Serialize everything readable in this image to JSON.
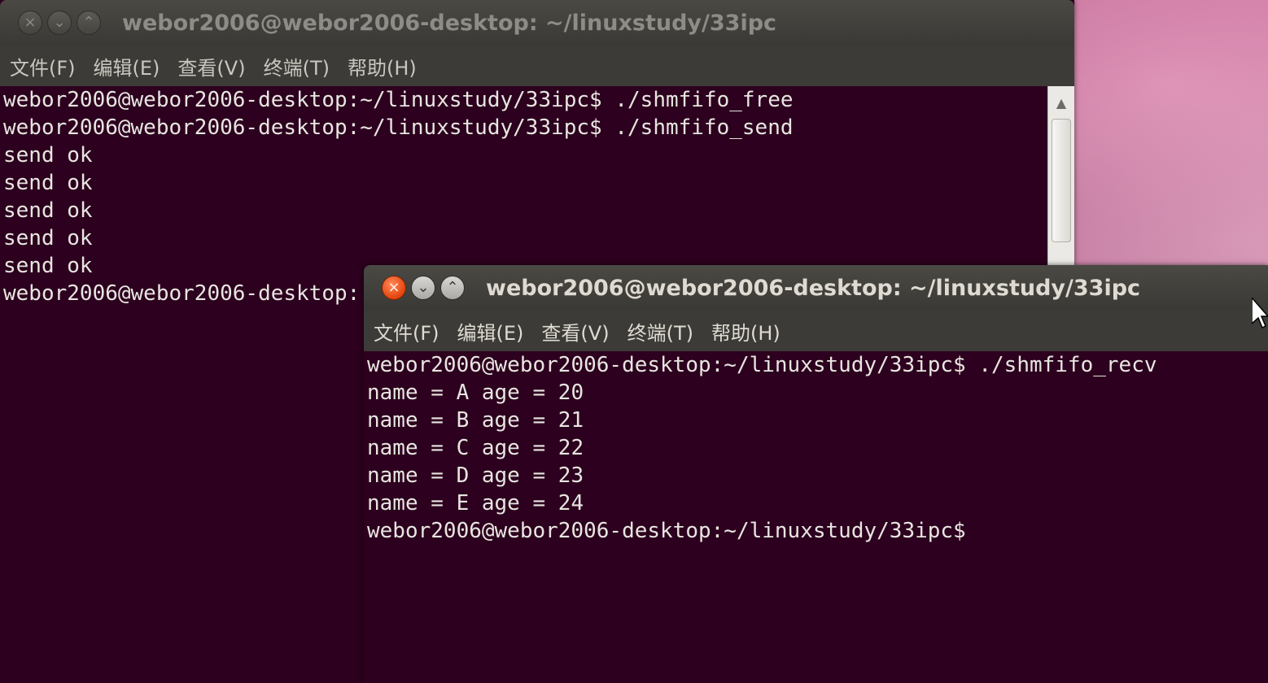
{
  "back_window": {
    "title": "webor2006@webor2006-desktop: ~/linuxstudy/33ipc",
    "controls": {
      "close_icon": "close-icon",
      "minimize_icon": "chevron-down-icon",
      "maximize_icon": "chevron-up-icon"
    },
    "menu": [
      "文件(F)",
      "编辑(E)",
      "查看(V)",
      "终端(T)",
      "帮助(H)"
    ],
    "lines": [
      "webor2006@webor2006-desktop:~/linuxstudy/33ipc$ ./shmfifo_free",
      "webor2006@webor2006-desktop:~/linuxstudy/33ipc$ ./shmfifo_send",
      "send ok",
      "send ok",
      "send ok",
      "send ok",
      "send ok",
      "webor2006@webor2006-desktop:"
    ]
  },
  "front_window": {
    "title": "webor2006@webor2006-desktop: ~/linuxstudy/33ipc",
    "controls": {
      "close_icon": "close-icon",
      "minimize_icon": "chevron-down-icon",
      "maximize_icon": "chevron-up-icon"
    },
    "menu": [
      "文件(F)",
      "编辑(E)",
      "查看(V)",
      "终端(T)",
      "帮助(H)"
    ],
    "lines": [
      "webor2006@webor2006-desktop:~/linuxstudy/33ipc$ ./shmfifo_recv",
      "name = A age = 20",
      "name = B age = 21",
      "name = C age = 22",
      "name = D age = 23",
      "name = E age = 24",
      "webor2006@webor2006-desktop:~/linuxstudy/33ipc$"
    ]
  },
  "colors": {
    "terminal_bg": "#2c001e",
    "terminal_fg": "#e8e5e0",
    "titlebar": "#3c3b37",
    "close_button": "#e3430c"
  }
}
